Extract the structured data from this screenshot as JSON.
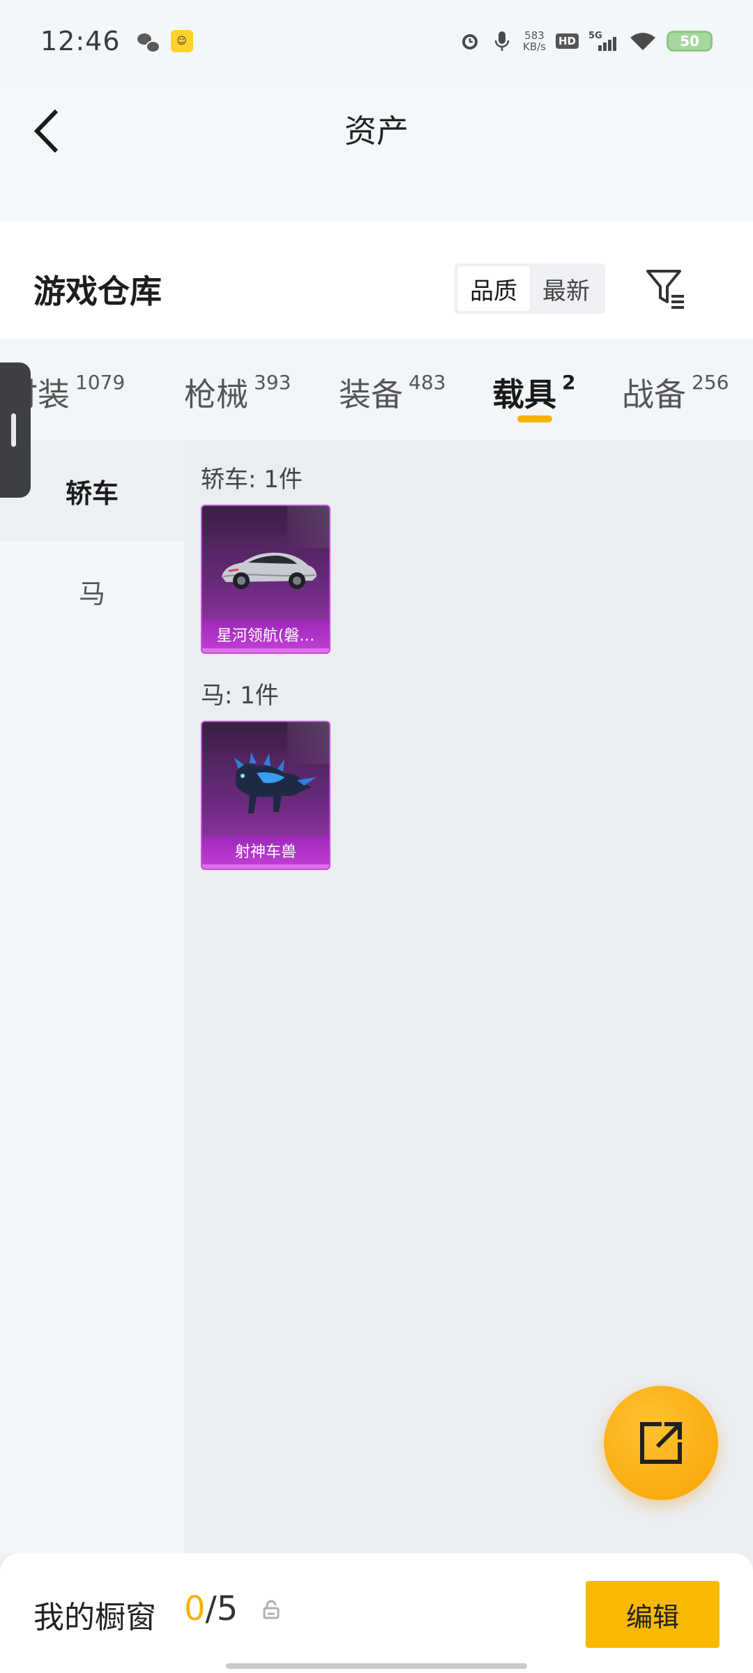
{
  "status_bar": {
    "time": "12:46",
    "net_speed_value": "583",
    "net_speed_unit": "KB/s",
    "hd": "HD",
    "signal": "5G",
    "battery": "50"
  },
  "header": {
    "title": "资产"
  },
  "warehouse": {
    "title": "游戏仓库",
    "sort_options": [
      "品质",
      "最新"
    ]
  },
  "tabs": [
    {
      "label": "时装",
      "count": "1079"
    },
    {
      "label": "枪械",
      "count": "393"
    },
    {
      "label": "装备",
      "count": "483"
    },
    {
      "label": "载具",
      "count": "2"
    },
    {
      "label": "战备",
      "count": "256"
    }
  ],
  "sidebar": {
    "items": [
      {
        "label": "轿车"
      },
      {
        "label": "马"
      }
    ]
  },
  "sections": [
    {
      "label": "轿车: 1件",
      "item_name": "星河领航(磐…"
    },
    {
      "label": "马: 1件",
      "item_name": "射神车兽"
    }
  ],
  "bottom_bar": {
    "title": "我的橱窗",
    "current": "0",
    "total": "/5",
    "edit_label": "编辑"
  },
  "colors": {
    "accent": "#f9b900",
    "card_epic": "#a639b9"
  }
}
